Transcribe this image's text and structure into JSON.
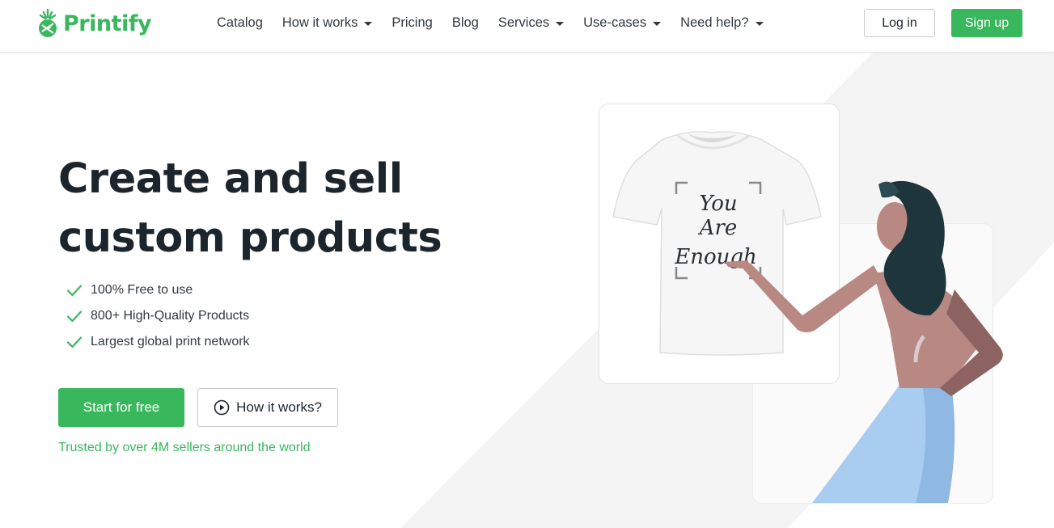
{
  "brand": {
    "name": "Printify",
    "accent_color": "#39b75d",
    "text_color": "#1d252c"
  },
  "nav": {
    "items": [
      {
        "label": "Catalog",
        "has_dropdown": false
      },
      {
        "label": "How it works",
        "has_dropdown": true
      },
      {
        "label": "Pricing",
        "has_dropdown": false
      },
      {
        "label": "Blog",
        "has_dropdown": false
      },
      {
        "label": "Services",
        "has_dropdown": true
      },
      {
        "label": "Use-cases",
        "has_dropdown": true
      },
      {
        "label": "Need help?",
        "has_dropdown": true
      }
    ],
    "login_label": "Log in",
    "signup_label": "Sign up"
  },
  "hero": {
    "headline": "Create and sell custom products",
    "features": [
      "100% Free to use",
      "800+ High-Quality Products",
      "Largest global print network"
    ],
    "cta_primary": "Start for free",
    "cta_secondary": "How it works?",
    "trusted_text": "Trusted by over 4M sellers around the world",
    "shirt_print": [
      "You",
      "Are",
      "Enough"
    ]
  },
  "icons": {
    "logo": "pineapple-logo-icon",
    "caret": "chevron-down-icon",
    "check": "check-icon",
    "play": "play-circle-icon"
  }
}
